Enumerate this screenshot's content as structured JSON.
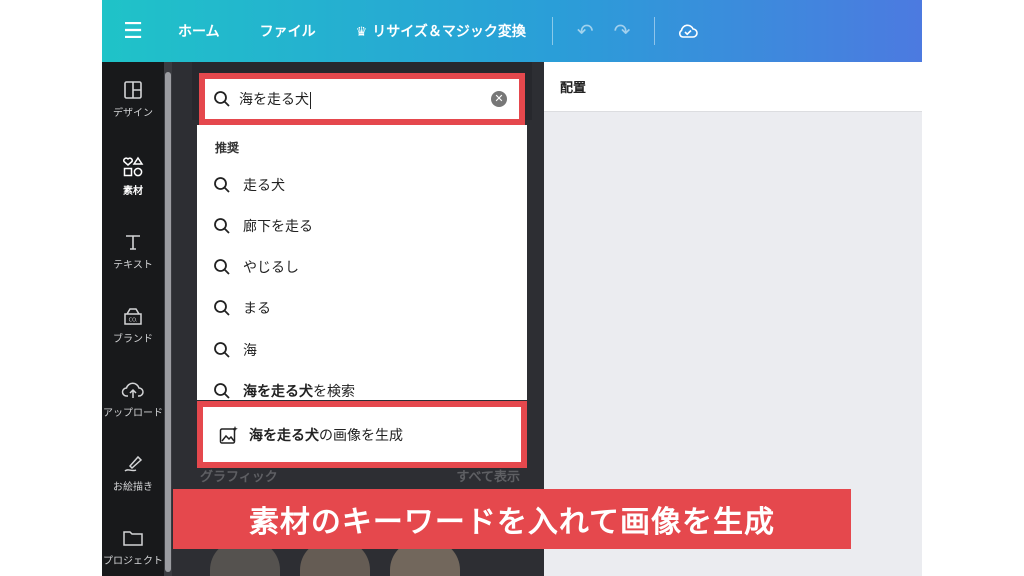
{
  "topbar": {
    "nav": [
      "ホーム",
      "ファイル",
      "リサイズ＆マジック変換"
    ]
  },
  "sidebar": {
    "items": [
      {
        "label": "デザイン",
        "icon": "layout-icon"
      },
      {
        "label": "素材",
        "icon": "shapes-icon",
        "active": true
      },
      {
        "label": "テキスト",
        "icon": "text-icon"
      },
      {
        "label": "ブランド",
        "icon": "brand-icon"
      },
      {
        "label": "アップロード",
        "icon": "upload-icon"
      },
      {
        "label": "お絵描き",
        "icon": "draw-icon"
      },
      {
        "label": "プロジェクト",
        "icon": "folder-icon"
      }
    ]
  },
  "search": {
    "value": "海を走る犬"
  },
  "suggestions": {
    "heading": "推奨",
    "items": [
      "走る犬",
      "廊下を走る",
      "やじるし",
      "まる",
      "海"
    ],
    "search_action": {
      "bold": "海を走る犬",
      "suffix": "を検索"
    }
  },
  "generate": {
    "bold": "海を走る犬",
    "suffix": "の画像を生成"
  },
  "panel_section": {
    "title": "グラフィック",
    "see_all": "すべて表示"
  },
  "canvas": {
    "toolbar_label": "配置"
  },
  "caption": "素材のキーワードを入れて画像を生成",
  "colors": {
    "highlight": "#e5484d",
    "sidebar": "#18191b",
    "panel": "#2d2e33"
  }
}
